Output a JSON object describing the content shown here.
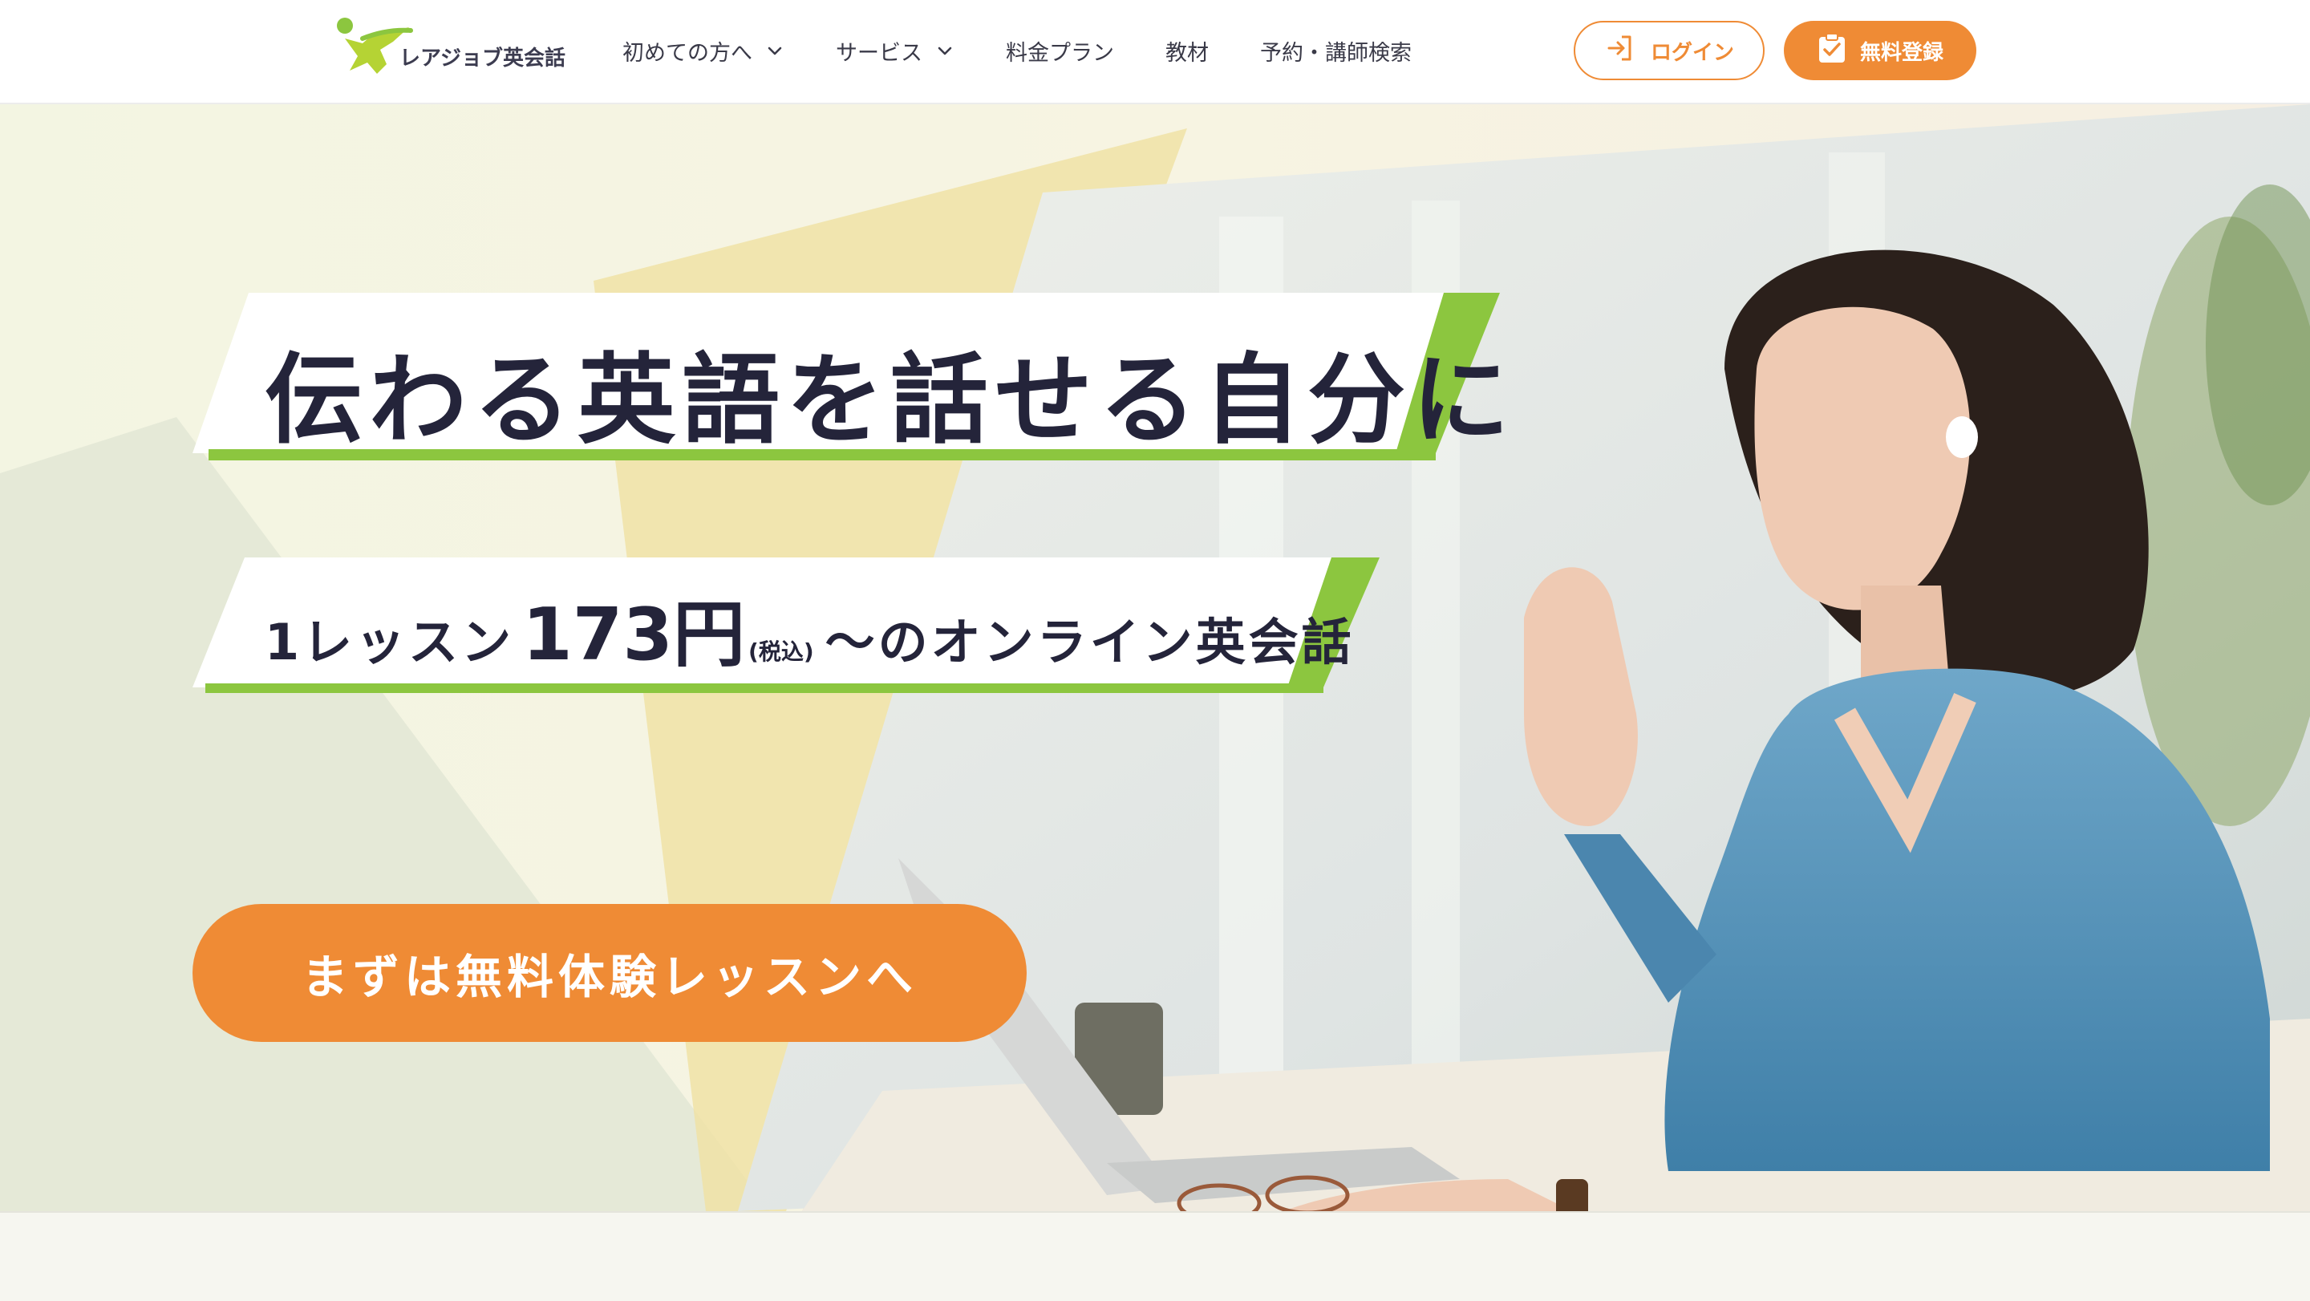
{
  "header": {
    "logo_text": "レアジョブ英会話",
    "nav": [
      {
        "label": "初めての方へ",
        "has_dropdown": true
      },
      {
        "label": "サービス",
        "has_dropdown": true
      },
      {
        "label": "料金プラン",
        "has_dropdown": false
      },
      {
        "label": "教材",
        "has_dropdown": false
      },
      {
        "label": "予約・講師検索",
        "has_dropdown": false
      }
    ],
    "login_label": "ログイン",
    "register_label": "無料登録"
  },
  "hero": {
    "headline": "伝わる英語を話せる自分に",
    "sub_lesson": "1レッスン",
    "sub_price": "173円",
    "sub_tax": "(税込)",
    "sub_rest": "〜のオンライン英会話",
    "cta_label": "まずは無料体験レッスンへ"
  },
  "colors": {
    "accent_orange": "#ef8b35",
    "accent_green": "#8cc63f",
    "text_dark": "#24243a"
  },
  "icons": {
    "login": "login-arrow-icon",
    "register": "clipboard-check-icon",
    "dropdown": "chevron-down-icon"
  }
}
